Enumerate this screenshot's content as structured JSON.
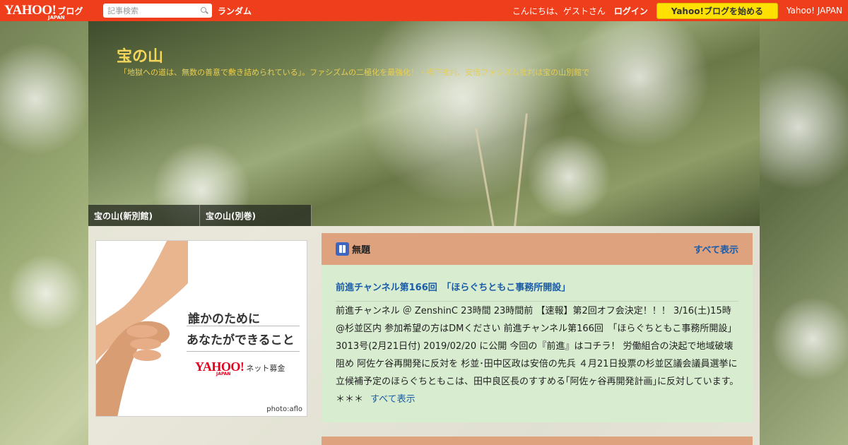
{
  "topbar": {
    "logo_main": "YAHOO!",
    "logo_sub": "ブログ",
    "logo_japan": "JAPAN",
    "search_placeholder": "記事検索",
    "random": "ランダム",
    "greeting": "こんにちは、ゲストさん",
    "login": "ログイン",
    "start_blog": "Yahoo!ブログを始める",
    "yahoo_japan": "Yahoo! JAPAN",
    "bar_color": "#ee3e1b",
    "button_color": "#ffe000"
  },
  "header": {
    "title": "宝の山",
    "description": "「地獄への道は、無数の善意で敷き詰められている」。ファシズムの二極化を最強化！・橋下批判、安倍ファシズム批判は宝の山別館で",
    "title_color": "#f3d75a"
  },
  "nav": {
    "tabs": [
      {
        "label": "宝の山(新別館)"
      },
      {
        "label": "宝の山(別巻)"
      }
    ]
  },
  "ad": {
    "line1": "誰かのために",
    "line2": "あなたができること",
    "logo": "YAHOO!",
    "logo_japan": "JAPAN",
    "logo_sub": "ネット募金",
    "credit": "photo:aflo"
  },
  "panel": {
    "icon": "book-icon",
    "title": "無題",
    "show_all": "すべて表示",
    "head_color": "#dfa27f",
    "body_color": "#d8ecd0",
    "post_title": "前進チャンネル第166回　「ほらぐちともこ事務所開設」",
    "post_body": "前進チャンネル ＠ ZenshinC 23時間 23時間前 【速報】第2回オフ会決定！！！ 3/16(土)15時 @杉並区内 参加希望の方はDMください 前進チャンネル第166回　「ほらぐちともこ事務所開設」 3013号(2月21日付) 2019/02/20 に公開 今回の『前進』はコチラ！ 労働組合の決起で地域破壊阻め 阿佐ケ谷再開発に反対を 杉並･田中区政は安倍の先兵 ４月21日投票の杉並区議会議員選挙に立候補予定のほらぐちともこは、田中良区長のすすめる｢阿佐ヶ谷再開発計画｣に反対しています。 ＊＊＊",
    "post_more": "すべて表示"
  }
}
